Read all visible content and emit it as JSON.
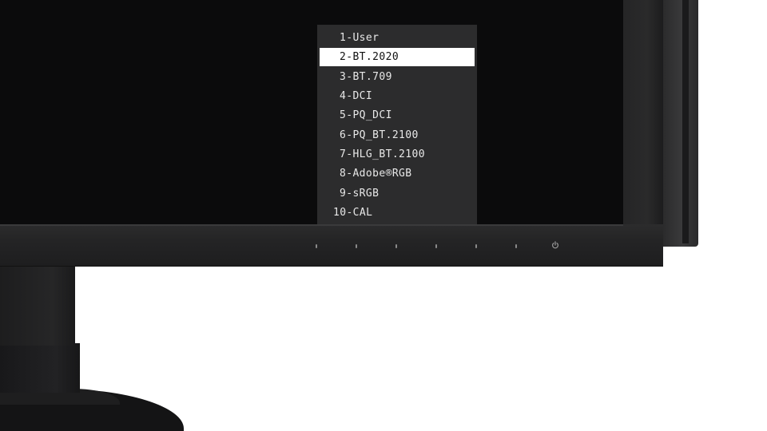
{
  "monitor": {
    "colors": {
      "screen": "#0b0b0c",
      "bezel": "#242425",
      "menu_background": "#2c2c2d",
      "menu_text": "#e8e8e8",
      "selected_background": "#ffffff",
      "selected_text": "#111111"
    },
    "bezel_buttons": [
      "button-1",
      "button-2",
      "button-3",
      "button-4",
      "button-5",
      "button-6"
    ],
    "power_icon": "power-icon"
  },
  "osd_menu": {
    "selected_index": 1,
    "items": [
      {
        "label": "1-User"
      },
      {
        "label": "2-BT.2020"
      },
      {
        "label": "3-BT.709"
      },
      {
        "label": "4-DCI"
      },
      {
        "label": "5-PQ_DCI"
      },
      {
        "label": "6-PQ_BT.2100"
      },
      {
        "label": "7-HLG_BT.2100"
      },
      {
        "label": "8-Adobe®RGB"
      },
      {
        "label": "9-sRGB"
      },
      {
        "label": "10-CAL"
      }
    ]
  }
}
